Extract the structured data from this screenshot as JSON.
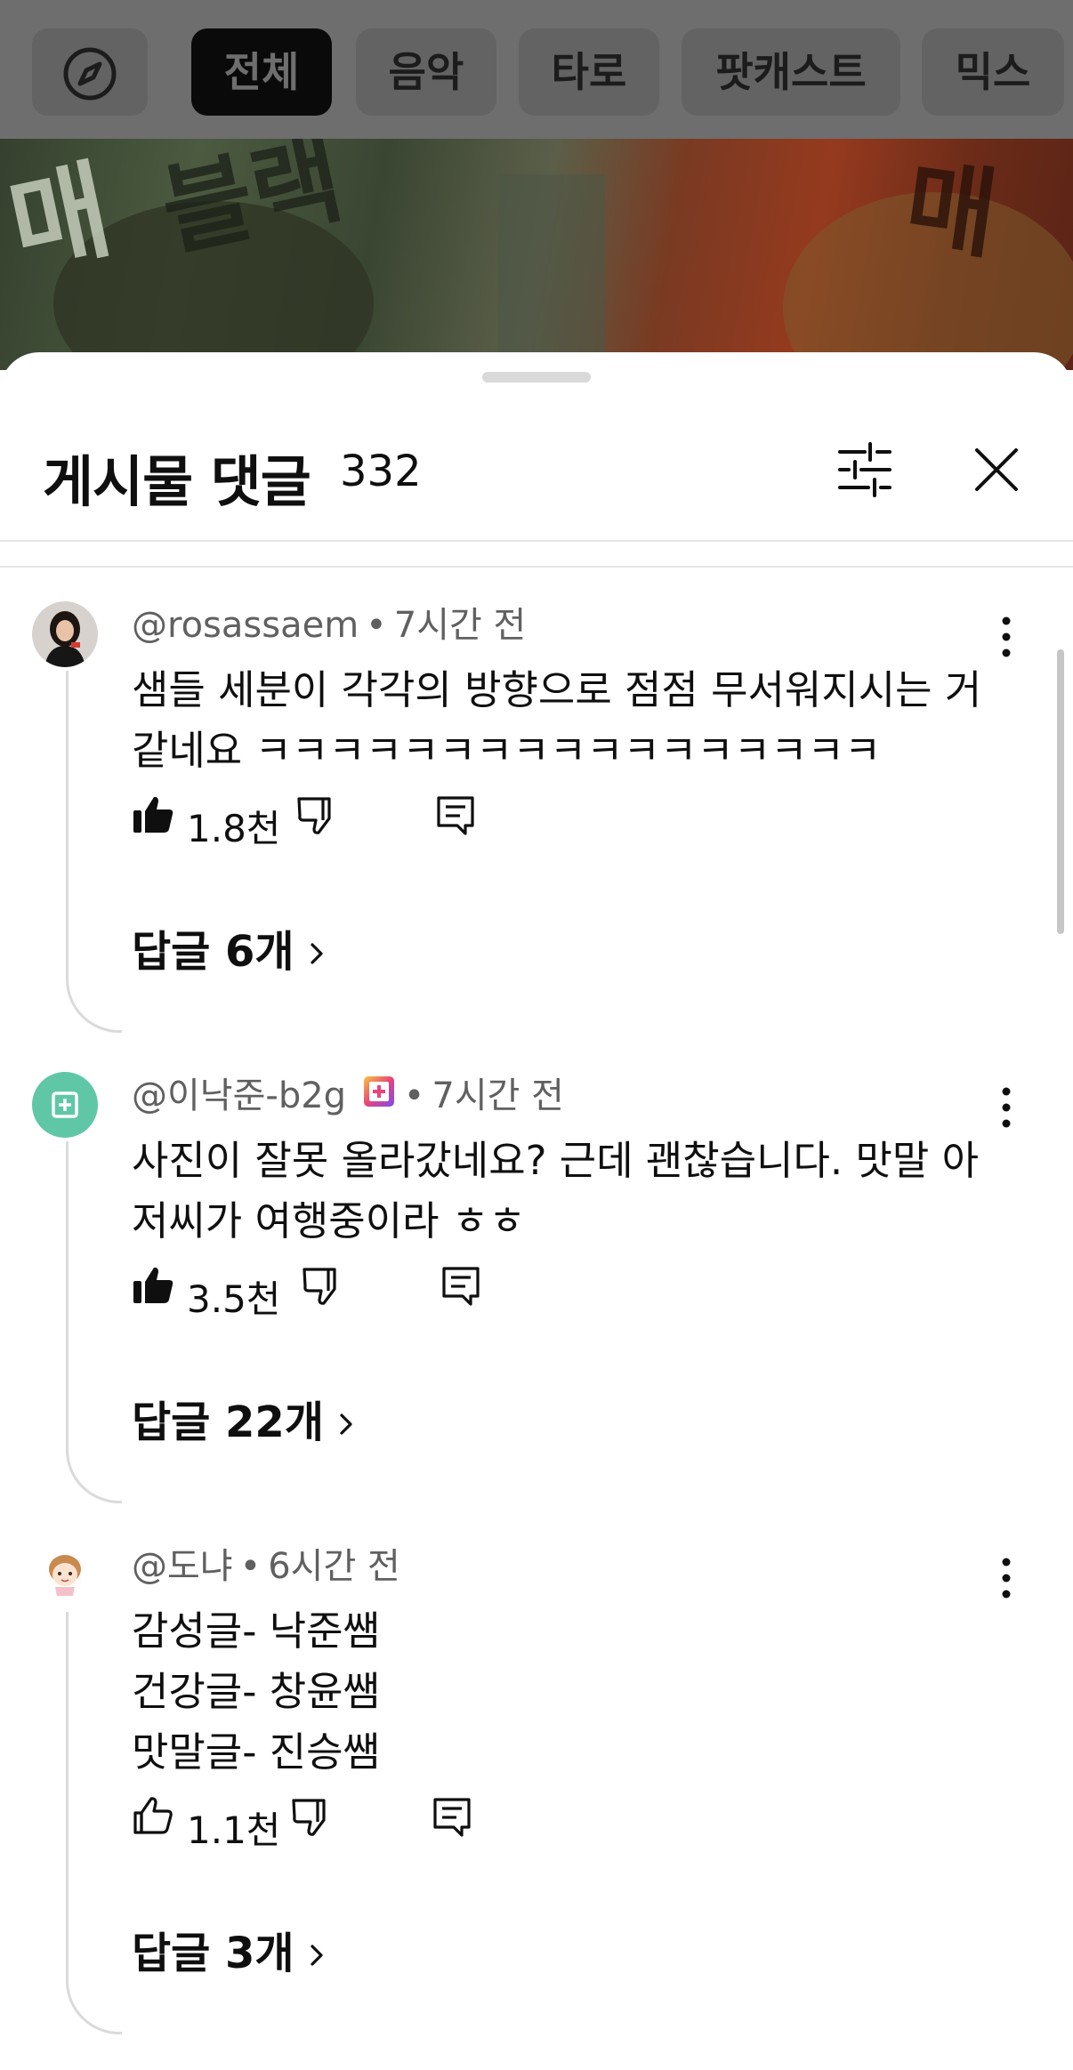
{
  "chips": [
    {
      "label": "전체",
      "active": true
    },
    {
      "label": "음악",
      "active": false
    },
    {
      "label": "타로",
      "active": false
    },
    {
      "label": "팟캐스트",
      "active": false
    },
    {
      "label": "믹스",
      "active": false
    }
  ],
  "explore_icon": "compass-icon",
  "thumbnail_marks": [
    "매",
    "블랙",
    "매"
  ],
  "sheet": {
    "title": "게시물 댓글",
    "count": "332",
    "filter_icon": "sliders-icon",
    "close_icon": "close-icon"
  },
  "comments": [
    {
      "handle": "@rosassaem",
      "time": "7시간 전",
      "text": "샘들 세분이 각각의 방향으로 점점 무서워지시는 거 같네요 ㅋㅋㅋㅋㅋㅋㅋㅋㅋㅋㅋㅋㅋㅋㅋㅋㅋ",
      "likes": "1.8천",
      "liked": true,
      "replies": "답글 6개",
      "avatar": "photo-avatar"
    },
    {
      "handle": "@이낙준-b2g",
      "time": "7시간 전",
      "text": "사진이 잘못 올라갔네요? 근데 괜찮습니다. 맛말 아저씨가 여행중이라 ㅎㅎ",
      "likes": "3.5천",
      "liked": true,
      "replies": "답글 22개",
      "avatar": "teal-avatar",
      "badge": "member-badge-icon"
    },
    {
      "handle": "@도냐",
      "time": "6시간 전",
      "lines": [
        "감성글- 낙준쌤",
        "건강글- 창윤쌤",
        "맛말글- 진승쌤"
      ],
      "likes": "1.1천",
      "liked": false,
      "replies": "답글 3개",
      "avatar": "cartoon-avatar"
    }
  ],
  "colors": {
    "text": "#0f0f0f",
    "meta": "#606060",
    "overlay": "#6e6e6e",
    "divider": "#e5e5e5"
  }
}
